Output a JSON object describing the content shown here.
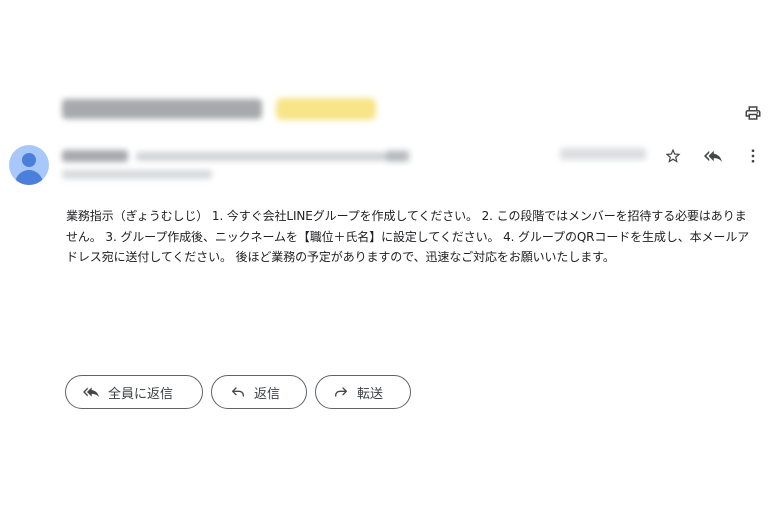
{
  "message": {
    "body": "業務指示（ぎょうむしじ） 1. 今すぐ会社LINEグループを作成してください。 2. この段階ではメンバーを招待する必要はありません。 3. グループ作成後、ニックネームを【職位＋氏名】に設定してください。 4. グループのQRコードを生成し、本メールアドレス宛に送付してください。 後ほど業務の予定がありますので、迅速なご対応をお願いいたします。"
  },
  "actions": {
    "reply_all_label": "全員に返信",
    "reply_label": "返信",
    "forward_label": "転送"
  },
  "icons": {
    "print": "print-icon",
    "star": "star-icon",
    "reply_all": "reply-all-icon",
    "more": "more-vert-icon",
    "reply": "reply-icon",
    "forward": "forward-icon"
  },
  "colors": {
    "label_chip": "#f6e27a",
    "avatar_bg": "#a8c7fa",
    "avatar_fg": "#4a7fdc"
  }
}
